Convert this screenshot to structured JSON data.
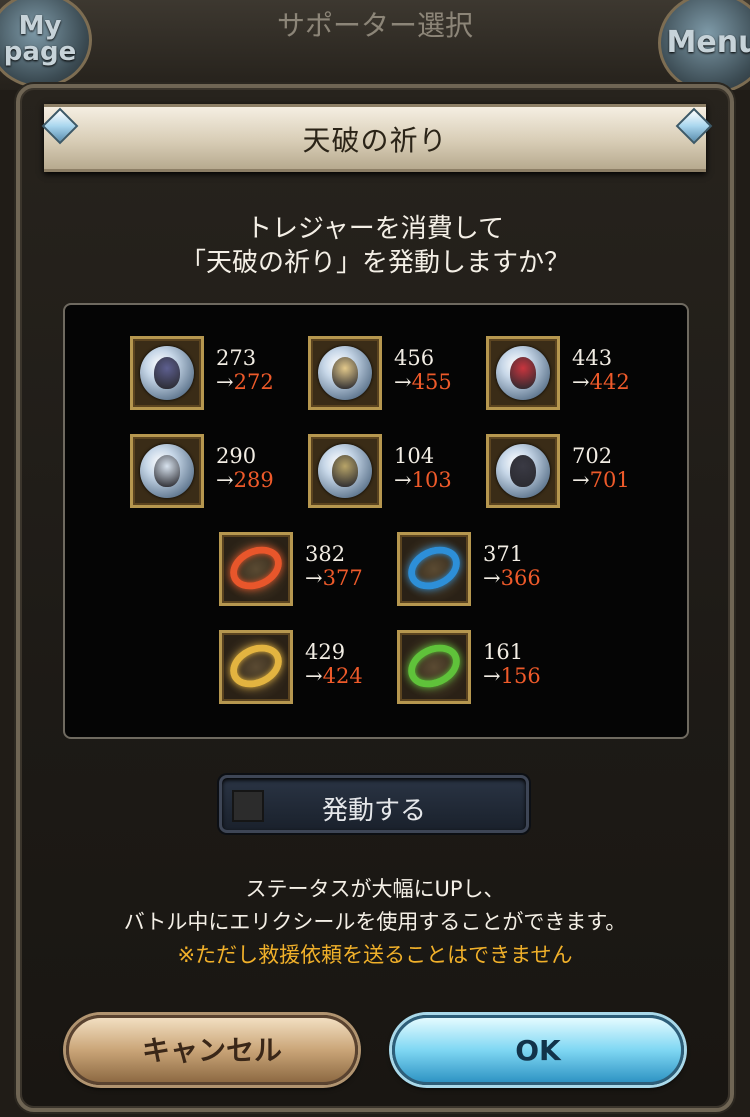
{
  "header": {
    "mypage_label": "My page",
    "screen_title": "サポーター選択",
    "menu_label": "Menu"
  },
  "dialog": {
    "title": "天破の祈り",
    "question_line1": "トレジャーを消費して",
    "question_line2": "「天破の祈り」を発動しますか？",
    "items": [
      {
        "icon": "character-dark-icon",
        "old": "273",
        "new": "272",
        "color": "#5d5f8f"
      },
      {
        "icon": "character-blonde-icon",
        "old": "456",
        "new": "455",
        "color": "#e3c98b"
      },
      {
        "icon": "character-redhead-icon",
        "old": "443",
        "new": "442",
        "color": "#c8353e"
      },
      {
        "icon": "character-silver-icon",
        "old": "290",
        "new": "289",
        "color": "#d8e3ef"
      },
      {
        "icon": "character-knight-icon",
        "old": "104",
        "new": "103",
        "color": "#b8a468"
      },
      {
        "icon": "character-shadow-icon",
        "old": "702",
        "new": "701",
        "color": "#3a3a44"
      },
      {
        "icon": "fire-ring-icon",
        "old": "382",
        "new": "377",
        "color": "#e8562b"
      },
      {
        "icon": "water-ring-icon",
        "old": "371",
        "new": "366",
        "color": "#2d8fd8"
      },
      {
        "icon": "light-ring-icon",
        "old": "429",
        "new": "424",
        "color": "#e3b440"
      },
      {
        "icon": "wind-ring-icon",
        "old": "161",
        "new": "156",
        "color": "#5fc23a"
      }
    ],
    "arrow": "→",
    "activate_label": "発動する",
    "info_line1": "ステータスが大幅にUPし、",
    "info_line2": "バトル中にエリクシールを使用することができます。",
    "warning": "※ただし救援依頼を送ることはできません",
    "cancel_label": "キャンセル",
    "ok_label": "OK"
  },
  "colors": {
    "new_value": "#ee5a2a",
    "warning": "#f0b02a"
  }
}
